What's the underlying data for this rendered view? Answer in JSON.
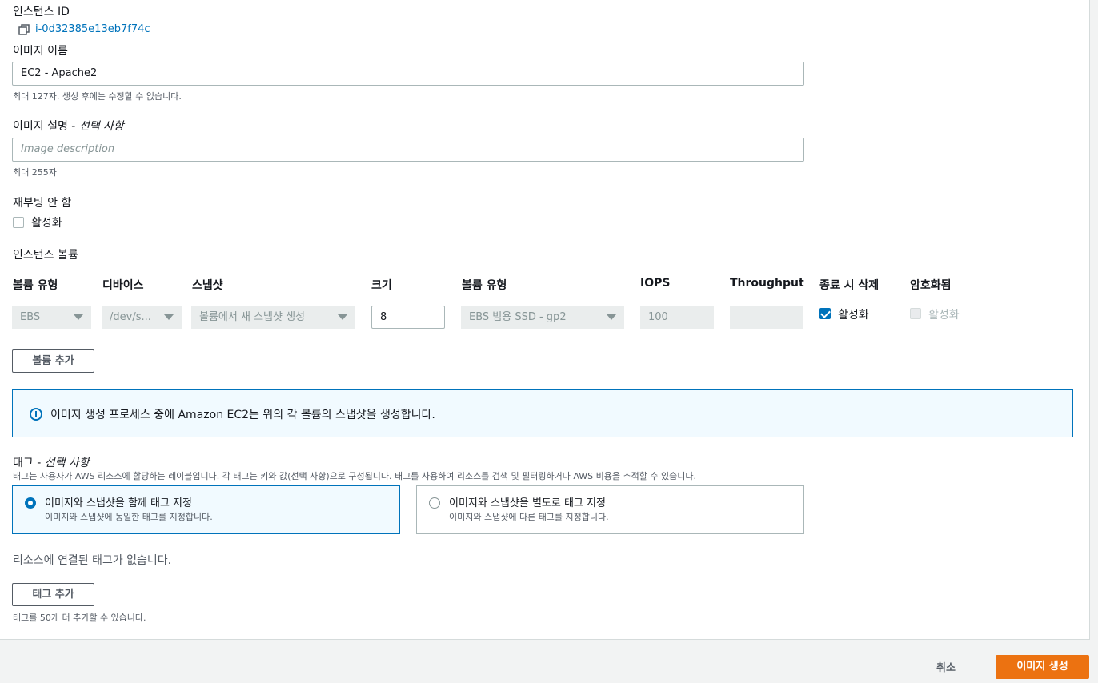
{
  "instance_id": {
    "label": "인스턴스 ID",
    "value": "i-0d32385e13eb7f74c"
  },
  "image_name": {
    "label": "이미지 이름",
    "value": "EC2 - Apache2",
    "hint": "최대 127자. 생성 후에는 수정할 수 없습니다."
  },
  "image_description": {
    "label": "이미지 설명 - ",
    "label_optional": "선택 사항",
    "placeholder": "Image description",
    "hint": "최대 255자"
  },
  "no_reboot": {
    "label": "재부팅 안 함",
    "checkbox_label": "활성화",
    "checked": false
  },
  "volumes": {
    "title": "인스턴스 볼륨",
    "headers": [
      "볼륨 유형",
      "디바이스",
      "스냅샷",
      "크기",
      "볼륨 유형",
      "IOPS",
      "Throughput",
      "종료 시 삭제",
      "암호화됨"
    ],
    "row": {
      "volume_type": "EBS",
      "device": "/dev/s...",
      "snapshot": "볼륨에서 새 스냅샷 생성",
      "size": "8",
      "ebs_type": "EBS 범용 SSD - gp2",
      "iops": "100",
      "throughput": "",
      "delete_on_termination": "활성화",
      "encrypted": "활성화"
    },
    "add_button": "볼륨 추가"
  },
  "info_message": "이미지 생성 프로세스 중에 Amazon EC2는 위의 각 볼륨의 스냅샷을 생성합니다.",
  "tags": {
    "label": "태그 - ",
    "label_optional": "선택 사항",
    "description": "태그는 사용자가 AWS 리소스에 할당하는 레이블입니다. 각 태그는 키와 값(선택 사항)으로 구성됩니다. 태그를 사용하여 리소스를 검색 및 필터링하거나 AWS 비용을 추적할 수 있습니다.",
    "options": [
      {
        "title": "이미지와 스냅샷을 함께 태그 지정",
        "subtitle": "이미지와 스냅샷에 동일한 태그를 지정합니다.",
        "selected": true
      },
      {
        "title": "이미지와 스냅샷을 별도로 태그 지정",
        "subtitle": "이미지와 스냅샷에 다른 태그를 지정합니다.",
        "selected": false
      }
    ],
    "empty_message": "리소스에 연결된 태그가 없습니다.",
    "add_button": "태그 추가",
    "add_hint": "태그를 50개 더 추가할 수 있습니다."
  },
  "footer": {
    "cancel": "취소",
    "create": "이미지 생성"
  },
  "colors": {
    "primary": "#ec7211",
    "link": "#0073bb",
    "info_border": "#0073bb"
  }
}
